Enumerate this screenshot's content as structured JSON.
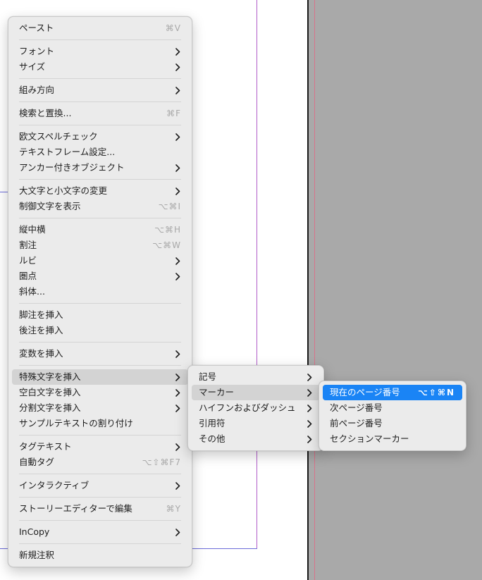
{
  "main_menu": {
    "groups": [
      [
        {
          "label": "ペースト",
          "shortcut": "⌘V"
        }
      ],
      [
        {
          "label": "フォント",
          "submenu": true
        },
        {
          "label": "サイズ",
          "submenu": true
        }
      ],
      [
        {
          "label": "組み方向",
          "submenu": true
        }
      ],
      [
        {
          "label": "検索と置換...",
          "shortcut": "⌘F"
        }
      ],
      [
        {
          "label": "欧文スペルチェック",
          "submenu": true
        },
        {
          "label": "テキストフレーム設定..."
        },
        {
          "label": "アンカー付きオブジェクト",
          "submenu": true
        }
      ],
      [
        {
          "label": "大文字と小文字の変更",
          "submenu": true
        },
        {
          "label": "制御文字を表示",
          "shortcut": "⌥⌘I"
        }
      ],
      [
        {
          "label": "縦中横",
          "shortcut": "⌥⌘H"
        },
        {
          "label": "割注",
          "shortcut": "⌥⌘W"
        },
        {
          "label": "ルビ",
          "submenu": true
        },
        {
          "label": "圏点",
          "submenu": true
        },
        {
          "label": "斜体..."
        }
      ],
      [
        {
          "label": "脚注を挿入"
        },
        {
          "label": "後注を挿入"
        }
      ],
      [
        {
          "label": "変数を挿入",
          "submenu": true
        }
      ],
      [
        {
          "label": "特殊文字を挿入",
          "submenu": true,
          "highlighted": true
        },
        {
          "label": "空白文字を挿入",
          "submenu": true
        },
        {
          "label": "分割文字を挿入",
          "submenu": true
        },
        {
          "label": "サンプルテキストの割り付け"
        }
      ],
      [
        {
          "label": "タグテキスト",
          "submenu": true
        },
        {
          "label": "自動タグ",
          "shortcut": "⌥⇧⌘F7"
        }
      ],
      [
        {
          "label": "インタラクティブ",
          "submenu": true
        }
      ],
      [
        {
          "label": "ストーリーエディターで編集",
          "shortcut": "⌘Y"
        }
      ],
      [
        {
          "label": "InCopy",
          "submenu": true
        }
      ],
      [
        {
          "label": "新規注釈"
        }
      ]
    ]
  },
  "special_chars_menu": {
    "items": [
      {
        "label": "記号",
        "submenu": true
      },
      {
        "label": "マーカー",
        "submenu": true,
        "highlighted": true
      },
      {
        "label": "ハイフンおよびダッシュ",
        "submenu": true
      },
      {
        "label": "引用符",
        "submenu": true
      },
      {
        "label": "その他",
        "submenu": true
      }
    ]
  },
  "marker_menu": {
    "items": [
      {
        "label": "現在のページ番号",
        "shortcut": "⌥⇧⌘N",
        "selected": true
      },
      {
        "label": "次ページ番号"
      },
      {
        "label": "前ページ番号"
      },
      {
        "label": "セクションマーカー"
      }
    ]
  },
  "colors": {
    "selection": "#1a84f5",
    "hover": "#d3d3d3",
    "menu_bg": "#ebebeb",
    "pasteboard": "#a9a9a9",
    "margin_guide": "#b05cc8",
    "bleed_guide": "#d9738a"
  }
}
